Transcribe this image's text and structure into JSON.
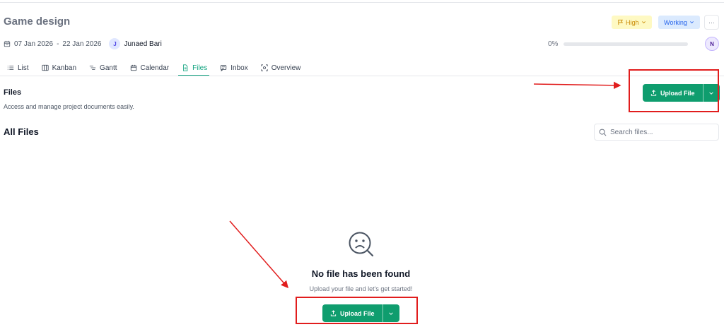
{
  "header": {
    "title": "Game design",
    "priority": "High",
    "status": "Working",
    "more": "···"
  },
  "meta": {
    "start_date": "07 Jan 2026",
    "separator": "-",
    "end_date": "22 Jan 2026",
    "assignee_initial": "J",
    "assignee_name": "Junaed Bari"
  },
  "progress": {
    "label": "0%",
    "value": 0
  },
  "user": {
    "initial": "N"
  },
  "tabs": [
    {
      "label": "List",
      "icon": "list-icon"
    },
    {
      "label": "Kanban",
      "icon": "kanban-icon"
    },
    {
      "label": "Gantt",
      "icon": "gantt-icon"
    },
    {
      "label": "Calendar",
      "icon": "calendar-icon"
    },
    {
      "label": "Files",
      "icon": "file-icon",
      "active": true
    },
    {
      "label": "Inbox",
      "icon": "inbox-icon"
    },
    {
      "label": "Overview",
      "icon": "overview-icon"
    }
  ],
  "files_section": {
    "title": "Files",
    "description": "Access and manage project documents easily.",
    "upload_label": "Upload File"
  },
  "all_files": {
    "title": "All Files",
    "search_placeholder": "Search files...",
    "search_value": ""
  },
  "empty_state": {
    "icon": "sad-search-icon",
    "title": "No file has been found",
    "description": "Upload your file and let's get started!",
    "upload_label": "Upload File"
  },
  "colors": {
    "accent": "#0f9d6e",
    "annotation": "#e11d1d",
    "priority_bg": "#fef9c3",
    "status_bg": "#dbeafe"
  }
}
